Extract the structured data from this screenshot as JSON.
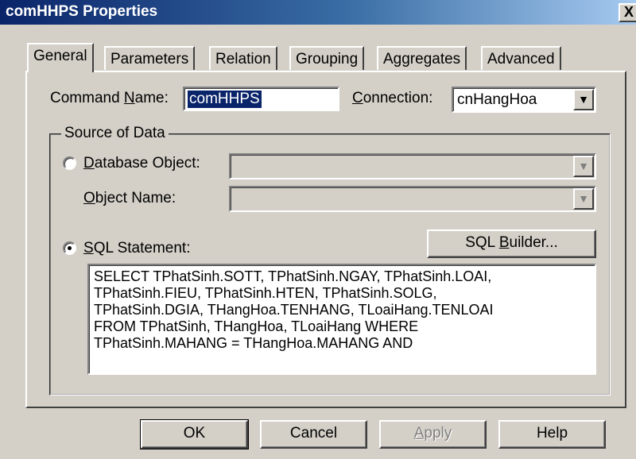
{
  "window": {
    "title": "comHHPS Properties",
    "close_label": "X"
  },
  "tabs": [
    "General",
    "Parameters",
    "Relation",
    "Grouping",
    "Aggregates",
    "Advanced"
  ],
  "active_tab": "General",
  "general": {
    "command_name_label_pre": "Command ",
    "command_name_label_u": "N",
    "command_name_label_post": "ame:",
    "command_name_value": "comHHPS",
    "connection_label_u": "C",
    "connection_label_post": "onnection:",
    "connection_value": "cnHangHoa",
    "source_group_title": "Source of Data",
    "database_object_u": "D",
    "database_object_post": "atabase Object:",
    "object_name_u": "O",
    "object_name_post": "bject Name:",
    "sql_statement_u": "S",
    "sql_statement_post": "QL Statement:",
    "sql_builder_pre": "SQL ",
    "sql_builder_u": "B",
    "sql_builder_post": "uilder...",
    "sql_text": "SELECT TPhatSinh.SOTT, TPhatSinh.NGAY, TPhatSinh.LOAI,\nTPhatSinh.FIEU, TPhatSinh.HTEN, TPhatSinh.SOLG,\nTPhatSinh.DGIA, THangHoa.TENHANG, TLoaiHang.TENLOAI\nFROM TPhatSinh, THangHoa, TLoaiHang WHERE\nTPhatSinh.MAHANG = THangHoa.MAHANG AND",
    "selected_source": "SQL Statement"
  },
  "buttons": {
    "ok": "OK",
    "cancel": "Cancel",
    "apply_u": "A",
    "apply_post": "pply",
    "help": "Help"
  },
  "icons": {
    "dropdown": "chevron-down-icon",
    "close": "close-icon"
  }
}
